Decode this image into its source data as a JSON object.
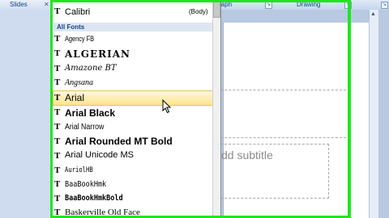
{
  "ribbon": {
    "slides_tab": "Slides",
    "paragraph_label": "raph",
    "drawing_label": "Drawing"
  },
  "slide": {
    "subtitle_placeholder": "dd subtitle"
  },
  "font_dropdown": {
    "theme_font": {
      "name": "Calibri",
      "tag": "(Body)"
    },
    "section_header": "All Fonts",
    "fonts": [
      "Agency FB",
      "ALGERIAN",
      "Amazone BT",
      "Angsana",
      "Arial",
      "Arial Black",
      "Arial Narrow",
      "Arial Rounded MT Bold",
      "Arial Unicode MS",
      "AuriolHB",
      "BaaBookHmk",
      "BaaBookHmkBold",
      "Baskerville Old Face"
    ],
    "hovered_font": "Arial"
  },
  "colors": {
    "frame": "#1de81d",
    "hover": "#ffe48f",
    "ribbon_text": "#15428b"
  }
}
